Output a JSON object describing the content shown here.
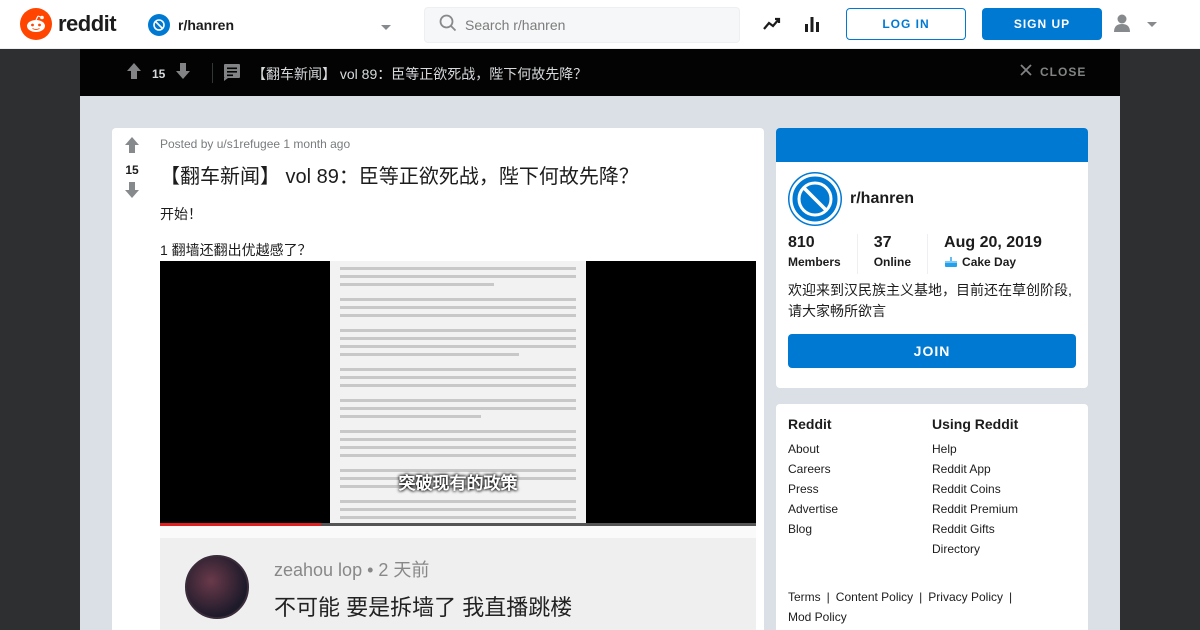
{
  "header": {
    "logo_text": "reddit",
    "community": "r/hanren",
    "search_placeholder": "Search r/hanren",
    "login_label": "LOG IN",
    "signup_label": "SIGN UP"
  },
  "overlay": {
    "votes": "15",
    "title": "【翻车新闻】 vol 89：臣等正欲死战，陛下何故先降？",
    "close_label": "CLOSE"
  },
  "post": {
    "votes": "15",
    "meta": "Posted by u/s1refugee 1 month ago",
    "title": "【翻车新闻】 vol 89：臣等正欲死战，陛下何故先降？",
    "paragraph1": "开始！",
    "paragraph2": "1 翻墙还翻出优越感了？",
    "video_subtitle": "突破现有的政策",
    "video_progress": 0.27,
    "comment_user": "zeahou lop • 2 天前",
    "comment_text": "不可能  要是拆墙了  我直播跳楼"
  },
  "sidebar": {
    "name": "r/hanren",
    "stats": [
      {
        "value": "810",
        "label": "Members"
      },
      {
        "value": "37",
        "label": "Online"
      },
      {
        "value": "Aug 20, 2019",
        "label": "Cake Day"
      }
    ],
    "description": "欢迎来到汉民族主义基地，目前还在草创阶段,请大家畅所欲言",
    "join_label": "JOIN"
  },
  "footer": {
    "col1_title": "Reddit",
    "col1_links": [
      "About",
      "Careers",
      "Press",
      "Advertise",
      "Blog"
    ],
    "col2_title": "Using Reddit",
    "col2_links": [
      "Help",
      "Reddit App",
      "Reddit Coins",
      "Reddit Premium",
      "Reddit Gifts",
      "Directory"
    ],
    "legal": [
      "Terms",
      "Content Policy",
      "Privacy Policy",
      "Mod Policy"
    ]
  },
  "colors": {
    "brand": "#ff4500",
    "accent": "#0079d3",
    "overlay_bg": "#030303",
    "page_bg": "#dae0e6"
  }
}
